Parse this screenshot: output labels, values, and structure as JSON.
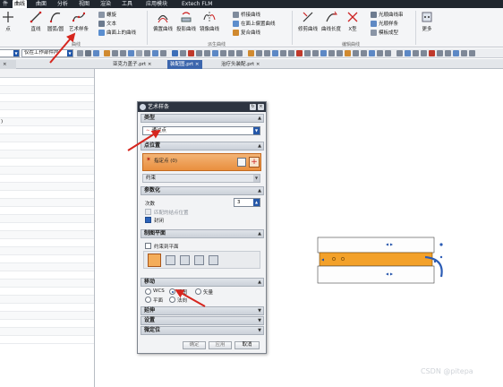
{
  "menubar": {
    "tabs": [
      "件",
      "曲线",
      "曲面",
      "分析",
      "视图",
      "渲染",
      "工具",
      "应用模块",
      "Extech FLM"
    ],
    "active": "曲线"
  },
  "ribbon": {
    "group1_buttons": [
      "点",
      "直线",
      "圆弧/圆",
      "艺术样条"
    ],
    "group1_small": [
      "螺旋",
      "文本",
      "曲面上的曲线"
    ],
    "group1_label": "曲线",
    "group2_buttons": [
      "偏置曲线",
      "投影曲线",
      "镜像曲线"
    ],
    "group2_small": [
      "桥接曲线",
      "在面上偏置曲线",
      "复合曲线"
    ],
    "group2_label": "派生曲线",
    "group3_buttons": [
      "修剪曲线",
      "曲线长度",
      "X型"
    ],
    "group3_small": [
      "光顺曲线串",
      "光顺样条",
      "模板成型"
    ],
    "group3_label": "编辑曲线",
    "more_label": "更多"
  },
  "toolbar": {
    "filter_value": "",
    "assembly_value": "仅在工作部件内"
  },
  "doc_tabs": [
    "亚克力盖子.prt",
    "装配图.prt",
    "治疗头装配.prt"
  ],
  "nav_rows": [
    "",
    "",
    "",
    "",
    "",
    ")",
    "",
    "",
    "",
    "",
    "",
    "",
    "",
    "",
    "",
    "",
    "",
    "",
    "",
    "",
    "",
    "",
    "",
    "",
    "",
    "",
    "",
    "",
    "",
    "",
    "",
    "",
    ""
  ],
  "dialog": {
    "title": "艺术样条",
    "sections": {
      "type": "类型",
      "points": "点位置",
      "param": "参数化",
      "plane": "制图平面",
      "move": "移动",
      "extend": "延伸",
      "settings": "设置",
      "fine": "微定位"
    },
    "type_value": "通过点",
    "specify_point": "指定点 (0)",
    "constraint": "约束",
    "degree_label": "次数",
    "degree_value": "3",
    "match_endpoints": "匹配的结点位置",
    "closed": "封闭",
    "constrain_plane": "约束到平面",
    "move_wcs": "WCS",
    "move_view": "视图",
    "move_vector": "矢量",
    "move_plane": "平面",
    "move_normal": "法向",
    "ok": "确定",
    "apply": "应用",
    "cancel": "取消"
  },
  "watermark": "CSDN @pitepa",
  "colors": {
    "ribbon_dark": "#20262e",
    "accent_blue": "#2557a8",
    "orange_highlight": "#e98f3e",
    "annotation_red": "#d6261e"
  }
}
